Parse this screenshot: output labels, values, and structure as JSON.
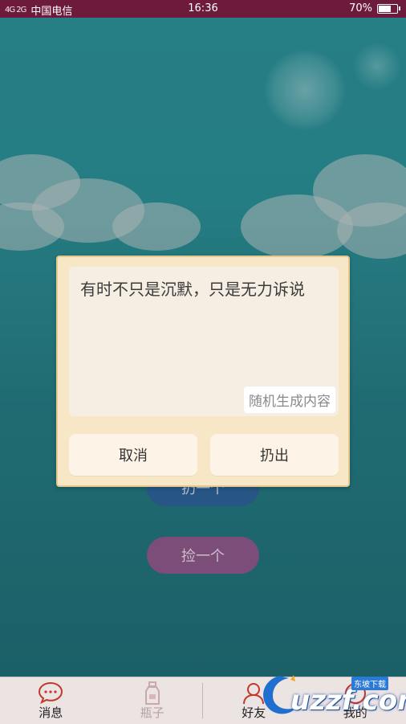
{
  "status_bar": {
    "signal_text": "4G 2G",
    "carrier": "中国电信",
    "time": "16:36",
    "battery": "70%"
  },
  "background_buttons": {
    "throw_one": "扔一个",
    "pick_one": "捡一个"
  },
  "dialog": {
    "message": "有时不只是沉默，只是无力诉说",
    "random_label": "随机生成内容",
    "cancel_label": "取消",
    "throw_label": "扔出"
  },
  "bottom_nav": {
    "items": [
      {
        "label": "消息",
        "icon": "chat-bubble-icon"
      },
      {
        "label": "瓶子",
        "icon": "bottle-icon"
      },
      {
        "label": "好友",
        "icon": "person-icon"
      },
      {
        "label": "我的",
        "icon": "profile-icon"
      }
    ]
  },
  "watermark": {
    "text": "uzzf.com",
    "tag": "东坡下载"
  },
  "colors": {
    "status_bar": "#6e1a3c",
    "dialog_bg": "#f7e7c7",
    "sea": "#247880",
    "throw_button": "#2c5f96",
    "pick_button": "#8a5686",
    "nav_accent": "#c0392b"
  }
}
